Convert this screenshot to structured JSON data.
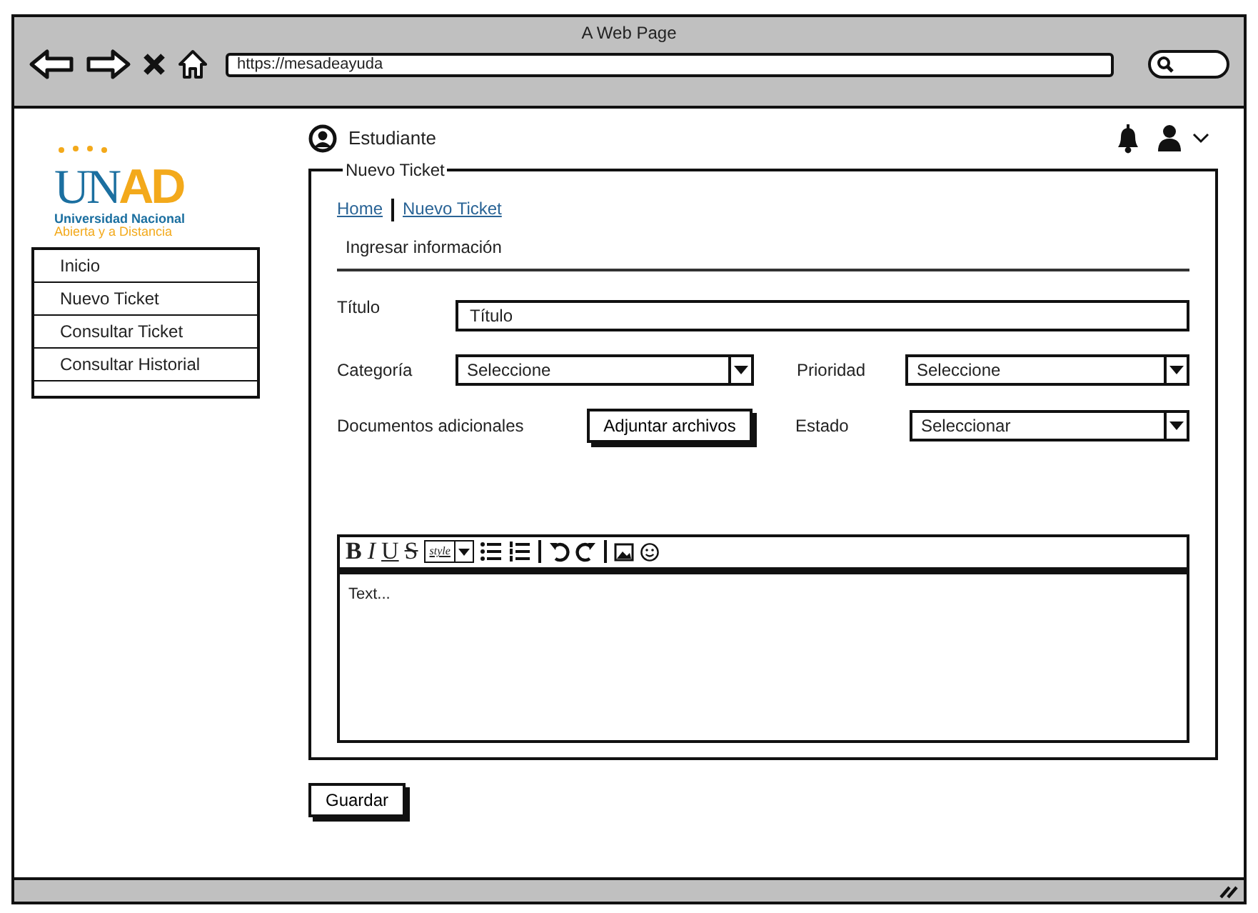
{
  "window": {
    "title": "A Web Page",
    "url": "https://mesadeayuda"
  },
  "logo": {
    "mark_primary": "UN",
    "mark_accent": "AD",
    "line1": "Universidad Nacional",
    "line2": "Abierta y a Distancia"
  },
  "sidebar": {
    "items": [
      {
        "label": "Inicio",
        "selected": false
      },
      {
        "label": "Nuevo Ticket",
        "selected": false
      },
      {
        "label": "Consultar Ticket",
        "selected": false
      },
      {
        "label": "Consultar Historial",
        "selected": false
      }
    ]
  },
  "user": {
    "name": "Estudiante"
  },
  "panel": {
    "title": "Nuevo Ticket",
    "breadcrumb": [
      "Home",
      "Nuevo Ticket"
    ],
    "section": "Ingresar información",
    "titulo": {
      "label": "Título",
      "value": "Título"
    },
    "categoria": {
      "label": "Categoría",
      "value": "Seleccione"
    },
    "prioridad": {
      "label": "Prioridad",
      "value": "Seleccione"
    },
    "documentos": {
      "label": "Documentos adicionales",
      "button": "Adjuntar archivos"
    },
    "estado": {
      "label": "Estado",
      "value": "Seleccionar"
    },
    "editor": {
      "toolbar": [
        {
          "kind": "bold",
          "label": "B"
        },
        {
          "kind": "italic",
          "label": "I"
        },
        {
          "kind": "underline",
          "label": "U"
        },
        {
          "kind": "strike",
          "label": "S"
        },
        {
          "kind": "style",
          "label": "style"
        },
        {
          "kind": "bullets"
        },
        {
          "kind": "numbers"
        },
        {
          "kind": "sep"
        },
        {
          "kind": "undo"
        },
        {
          "kind": "redo"
        },
        {
          "kind": "sep"
        },
        {
          "kind": "image"
        },
        {
          "kind": "emoji"
        }
      ],
      "placeholder": "Text..."
    }
  },
  "save_button": "Guardar"
}
